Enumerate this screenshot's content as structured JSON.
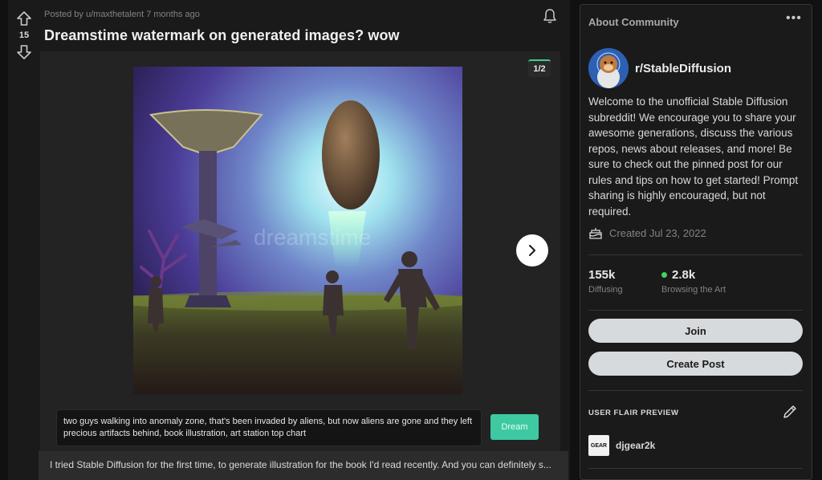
{
  "post": {
    "score": "15",
    "meta": "Posted by u/maxthetalent 7 months ago",
    "title": "Dreamstime watermark on generated images? wow",
    "gallery_counter": "1/2",
    "watermark": "dreamstime",
    "prompt": "two guys walking into anomaly zone, that's been invaded by aliens, but now aliens are gone and they left precious artifacts behind, book illustration, art station top chart",
    "dream_label": "Dream",
    "body_preview": "I tried Stable Diffusion for the first time, to generate illustration for the book I'd read recently. And you can definitely s...",
    "icons": [
      "upvote-icon",
      "downvote-icon",
      "bell-icon",
      "chevron-right-icon"
    ]
  },
  "sidebar": {
    "header": "About Community",
    "more": "•••",
    "community_name": "r/StableDiffusion",
    "description": "Welcome to the unofficial Stable Diffusion subreddit! We encourage you to share your awesome generations, discuss the various repos, news about releases, and more! Be sure to check out the pinned post for our rules and tips on how to get started! Prompt sharing is highly encouraged, but not required.",
    "created": "Created Jul 23, 2022",
    "members_count": "155k",
    "members_label": "Diffusing",
    "online_count": "2.8k",
    "online_label": "Browsing the Art",
    "join_label": "Join",
    "create_post_label": "Create Post",
    "flair_header": "USER FLAIR PREVIEW",
    "flair_user_avatar": "GEAR",
    "flair_username": "djgear2k",
    "icons": [
      "cake-icon",
      "pencil-icon",
      "more-icon"
    ]
  },
  "colors": {
    "background": "#111112",
    "card": "#1a1a1b",
    "accent_dream": "#3ec9a2",
    "online_dot": "#46d160",
    "pill": "#d7dadc"
  }
}
